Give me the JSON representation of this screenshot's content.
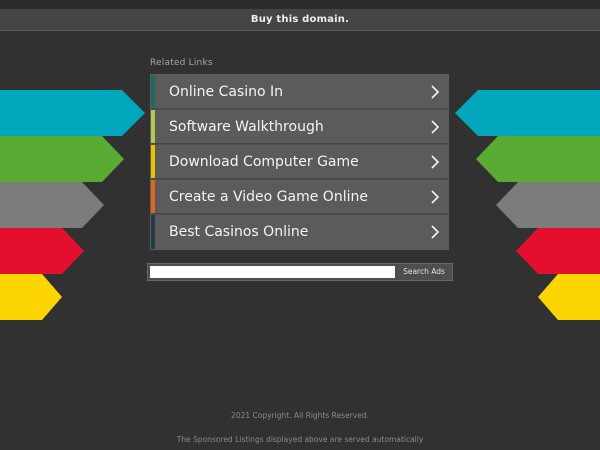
{
  "header": {
    "buy_label": "Buy this domain."
  },
  "colors": {
    "background": "#313131",
    "cyan": "#00a6bc",
    "green": "#5aab33",
    "gray": "#7c7c7c",
    "red": "#e40f2f",
    "yellow": "#fdd500",
    "accent_teal": "#1d6b5d",
    "accent_lime": "#b3c94c",
    "accent_yellow": "#e7c400",
    "accent_orange": "#e1651b",
    "accent_dark": "#223a44"
  },
  "related": {
    "label": "Related Links",
    "links": [
      {
        "label": "Online Casino In",
        "icon": "chevron-right-icon"
      },
      {
        "label": "Software Walkthrough",
        "icon": "chevron-right-icon"
      },
      {
        "label": "Download Computer Game",
        "icon": "chevron-right-icon"
      },
      {
        "label": "Create a Video Game Online",
        "icon": "chevron-right-icon"
      },
      {
        "label": "Best Casinos Online",
        "icon": "chevron-right-icon"
      }
    ]
  },
  "search": {
    "value": "",
    "placeholder": "",
    "button_label": "Search Ads"
  },
  "footer": {
    "copyright": "2021 Copyright. All Rights Reserved.",
    "disclaimer": "The Sponsored Listings displayed above are served automatically"
  }
}
